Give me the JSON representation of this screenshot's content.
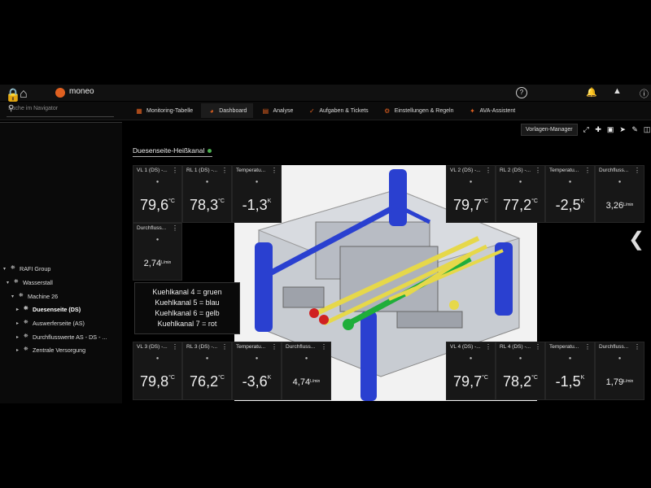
{
  "header": {
    "brand": "moneo",
    "icons": [
      "lock-icon",
      "home-icon",
      "help-icon",
      "bell-icon",
      "warning-icon",
      "info-icon"
    ]
  },
  "search": {
    "placeholder": "Suche im Navigator"
  },
  "tabs": [
    {
      "label": "Monitoring-Tabelle",
      "icon": "table-icon"
    },
    {
      "label": "Dashboard",
      "icon": "gauge-icon"
    },
    {
      "label": "Analyse",
      "icon": "chart-icon"
    },
    {
      "label": "Aufgaben & Tickets",
      "icon": "tasks-icon"
    },
    {
      "label": "Einstellungen & Regeln",
      "icon": "rules-icon"
    },
    {
      "label": "AVA-Assistent",
      "icon": "assistant-icon"
    }
  ],
  "tree": [
    {
      "label": "RAFI Group"
    },
    {
      "label": "Wasserstall"
    },
    {
      "label": "Machine 26"
    },
    {
      "label": "Duesenseite (DS)"
    },
    {
      "label": "Auswerferseite (AS)"
    },
    {
      "label": "Durchflusswerte AS - DS - ..."
    },
    {
      "label": "Zentrale Versorgung"
    }
  ],
  "dashboard": {
    "title": "Duesenseite-Heißkanal",
    "toolbar_label": "Vorlagen-Manager",
    "status_color": "#4caf50"
  },
  "widgets": {
    "vl1": {
      "title": "VL 1 (DS) -...",
      "value": "79,6",
      "unit": "°C"
    },
    "rl1": {
      "title": "RL 1 (DS) -...",
      "value": "78,3",
      "unit": "°C"
    },
    "t1": {
      "title": "Temperatu...",
      "value": "-1,3",
      "unit": "K"
    },
    "f1": {
      "title": "Durchfluss...",
      "value": "2,74",
      "unit": "L/min"
    },
    "vl2": {
      "title": "VL 2 (DS) -...",
      "value": "79,7",
      "unit": "°C"
    },
    "rl2": {
      "title": "RL 2 (DS) -...",
      "value": "77,2",
      "unit": "°C"
    },
    "t2": {
      "title": "Temperatu...",
      "value": "-2,5",
      "unit": "K"
    },
    "f2": {
      "title": "Durchfluss...",
      "value": "3,26",
      "unit": "L/min"
    },
    "vl3": {
      "title": "VL 3 (DS) -...",
      "value": "79,8",
      "unit": "°C"
    },
    "rl3": {
      "title": "RL 3 (DS) -...",
      "value": "76,2",
      "unit": "°C"
    },
    "t3": {
      "title": "Temperatu...",
      "value": "-3,6",
      "unit": "K"
    },
    "f3": {
      "title": "Durchfluss...",
      "value": "4,74",
      "unit": "L/min"
    },
    "vl4": {
      "title": "VL 4 (DS) -...",
      "value": "79,7",
      "unit": "°C"
    },
    "rl4": {
      "title": "RL 4 (DS) -...",
      "value": "78,2",
      "unit": "°C"
    },
    "t4": {
      "title": "Temperatu...",
      "value": "-1,5",
      "unit": "K"
    },
    "f4": {
      "title": "Durchfluss...",
      "value": "1,79",
      "unit": "L/min"
    }
  },
  "legend": [
    "Kuehlkanal 4 = gruen",
    "Kuehlkanal 5 = blau",
    "Kuehlkanal 6 = gelb",
    "Kuehlkanal 7 = rot"
  ]
}
